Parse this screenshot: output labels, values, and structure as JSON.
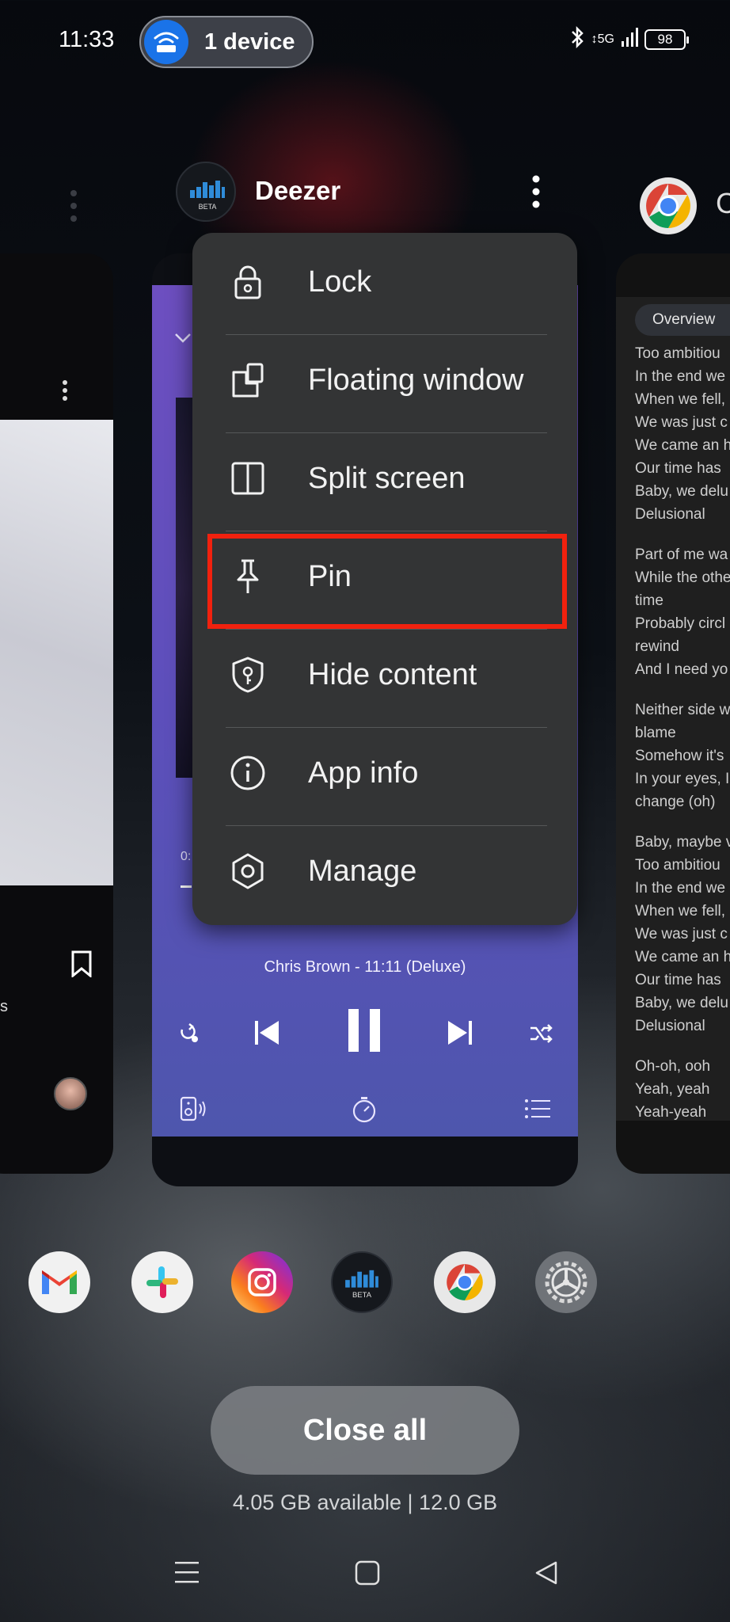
{
  "status_bar": {
    "time": "11:33",
    "device_pill": "1 device",
    "network": "5G",
    "battery": "98"
  },
  "center_card": {
    "app_name": "Deezer",
    "logo_badge": "BETA",
    "time_elapsed": "0:",
    "track_line": "Chris Brown - 11:11 (Deluxe)"
  },
  "context_menu": {
    "items": [
      {
        "label": "Lock",
        "icon": "lock-icon"
      },
      {
        "label": "Floating window",
        "icon": "floating-window-icon"
      },
      {
        "label": "Split screen",
        "icon": "split-screen-icon"
      },
      {
        "label": "Pin",
        "icon": "pin-icon",
        "highlighted": true
      },
      {
        "label": "Hide content",
        "icon": "shield-key-icon"
      },
      {
        "label": "App info",
        "icon": "info-icon"
      },
      {
        "label": "Manage",
        "icon": "hexagon-settings-icon"
      }
    ]
  },
  "right_card": {
    "chip": "Overview",
    "lyrics": [
      "Too ambitiou",
      "In the end we",
      "When we fell,",
      "We was just c",
      "We came an h",
      "Our time has",
      "Baby, we delu",
      "Delusional",
      "",
      "Part of me wa",
      "While the othe",
      "time",
      "Probably circl",
      "rewind",
      "And I need yo",
      "",
      "Neither side w",
      "blame",
      "Somehow it's",
      "In your eyes, I",
      "change (oh)",
      "",
      "Baby, maybe v",
      "Too ambitiou",
      "In the end we",
      "When we fell,",
      "We was just c",
      "We came an h",
      "Our time has",
      "Baby, we delu",
      "Delusional",
      "",
      "Oh-oh, ooh",
      "Yeah, yeah",
      "Yeah-yeah"
    ]
  },
  "right_header_letter": "C",
  "left_card_text": "s",
  "dock": [
    {
      "name": "gmail-icon"
    },
    {
      "name": "slack-icon"
    },
    {
      "name": "instagram-icon"
    },
    {
      "name": "deezer-icon",
      "badge": "BETA"
    },
    {
      "name": "chrome-icon"
    },
    {
      "name": "settings-icon"
    }
  ],
  "close_all_label": "Close all",
  "memory": "4.05 GB available | 12.0 GB",
  "colors": {
    "highlight_border": "#f1210e",
    "menu_bg": "#333435",
    "player_purple": "#6d4fc0",
    "wifi_blue": "#1a73e8"
  }
}
